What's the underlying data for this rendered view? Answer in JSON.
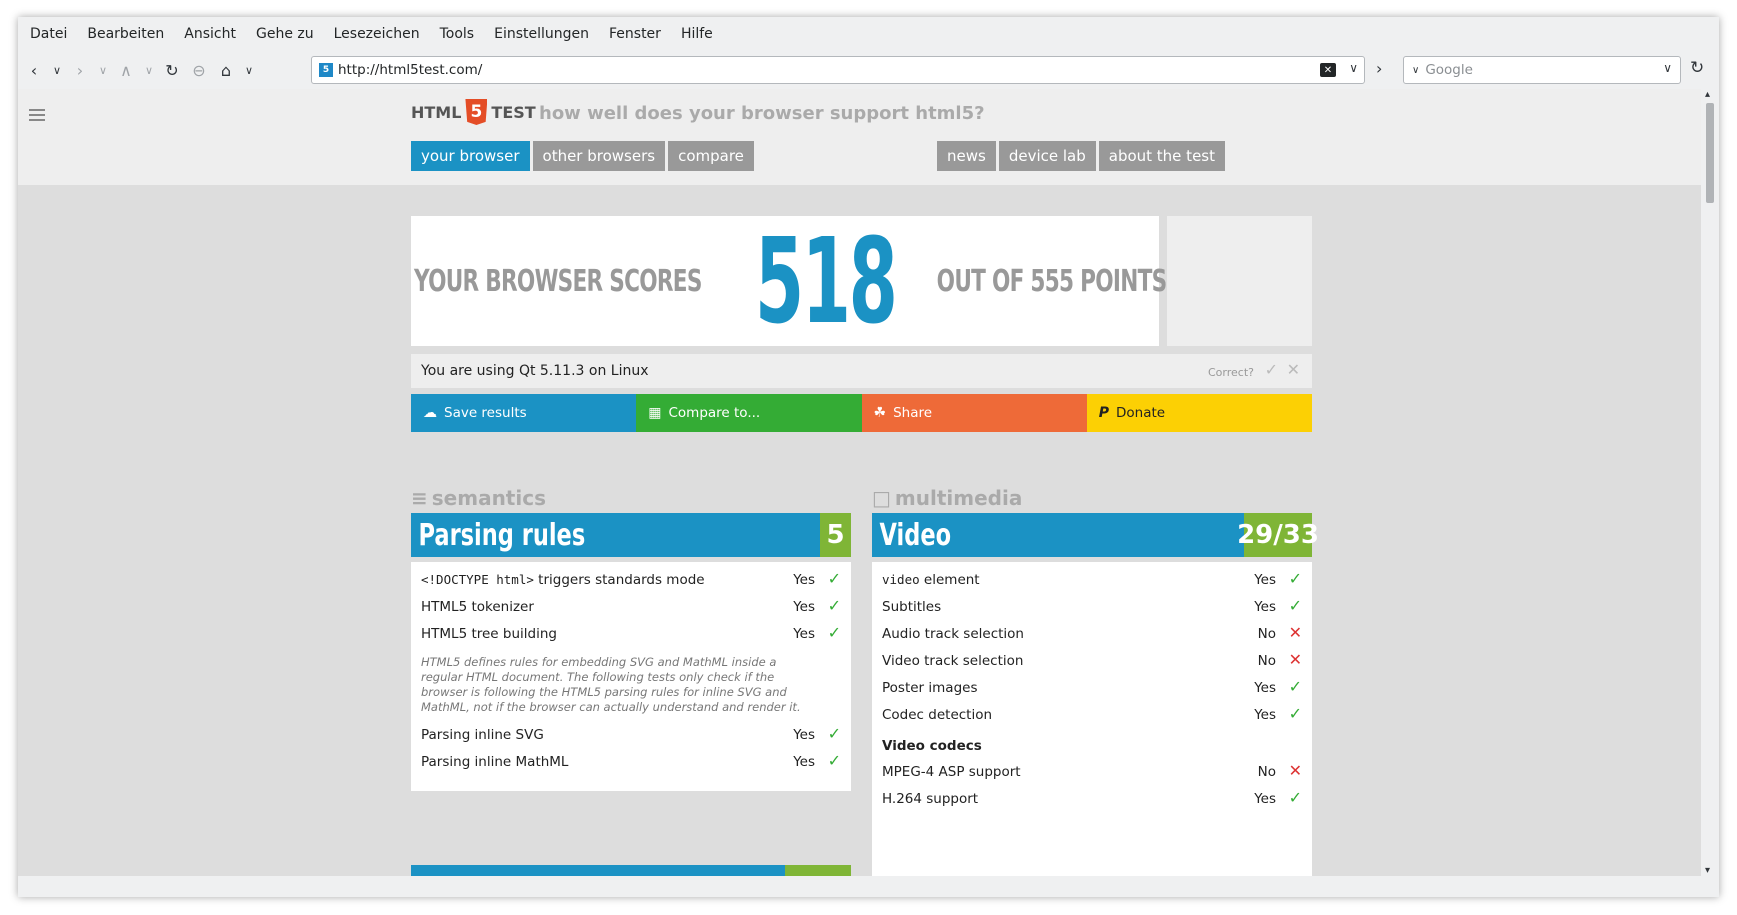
{
  "menubar": [
    "Datei",
    "Bearbeiten",
    "Ansicht",
    "Gehe zu",
    "Lesezeichen",
    "Tools",
    "Einstellungen",
    "Fenster",
    "Hilfe"
  ],
  "urlbar": {
    "url": "http://html5test.com/"
  },
  "searchbar": {
    "engine": "Google"
  },
  "site": {
    "logo_left": "HTML",
    "logo_num": "5",
    "logo_right": "TEST",
    "tagline": "how well does your browser support html5?",
    "nav_left": [
      "your browser",
      "other browsers",
      "compare"
    ],
    "nav_right": [
      "news",
      "device lab",
      "about the test"
    ]
  },
  "score": {
    "prefix": "YOUR BROWSER SCORES",
    "value": "518",
    "suffix": "OUT OF 555 POINTS"
  },
  "using": {
    "text": "You are using Qt 5.11.3 on Linux",
    "correct": "Correct?"
  },
  "actions": {
    "save": "Save results",
    "compare": "Compare to...",
    "share": "Share",
    "donate": "Donate"
  },
  "semantics": {
    "section": "semantics",
    "category": "Parsing rules",
    "score": "5",
    "tests_a": [
      {
        "code": "<!DOCTYPE html>",
        "label": " triggers standards mode",
        "result": "Yes"
      },
      {
        "label": "HTML5 tokenizer",
        "result": "Yes"
      },
      {
        "label": "HTML5 tree building",
        "result": "Yes"
      }
    ],
    "note": "HTML5 defines rules for embedding SVG and MathML inside a regular HTML document. The following tests only check if the browser is following the HTML5 parsing rules for inline SVG and MathML, not if the browser can actually understand and render it.",
    "tests_b": [
      {
        "label": "Parsing inline SVG",
        "result": "Yes"
      },
      {
        "label": "Parsing inline MathML",
        "result": "Yes"
      }
    ]
  },
  "multimedia": {
    "section": "multimedia",
    "category": "Video",
    "score": "29/33",
    "tests_a": [
      {
        "code": "video",
        "label": " element",
        "result": "Yes"
      },
      {
        "label": "Subtitles",
        "result": "Yes"
      },
      {
        "label": "Audio track selection",
        "result": "No"
      },
      {
        "label": "Video track selection",
        "result": "No"
      },
      {
        "label": "Poster images",
        "result": "Yes"
      },
      {
        "label": "Codec detection",
        "result": "Yes"
      }
    ],
    "subhead": "Video codecs",
    "tests_b": [
      {
        "label": "MPEG-4 ASP support",
        "result": "No"
      },
      {
        "label": "H.264 support",
        "result": "Yes"
      }
    ]
  }
}
